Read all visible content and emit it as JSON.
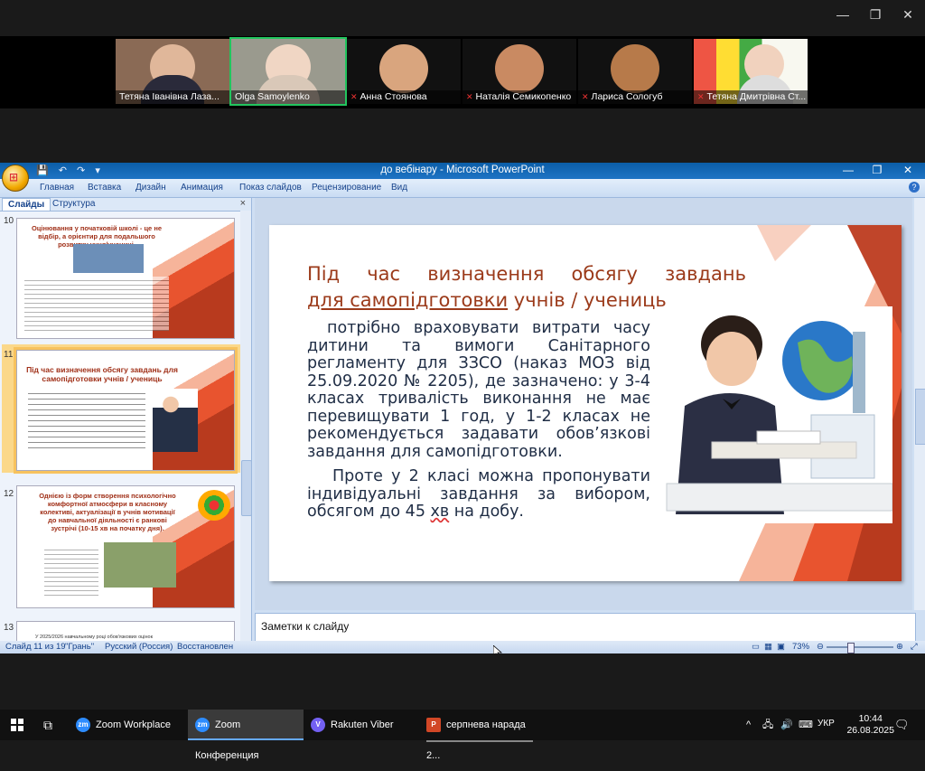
{
  "zoom": {
    "participants": [
      {
        "name": "Тетяна Іванівна Лаза...",
        "muted": false
      },
      {
        "name": "Olga Samoylenko",
        "muted": false
      },
      {
        "name": "Анна Стоянова",
        "muted": true
      },
      {
        "name": "Наталія Семикопенко",
        "muted": true
      },
      {
        "name": "Лариса Сологуб",
        "muted": true
      },
      {
        "name": "Тетяна Дмитрівна Ст...",
        "muted": true
      }
    ],
    "window_controls": {
      "minimize": "—",
      "restore": "❐",
      "close": "✕"
    }
  },
  "ppt": {
    "window_title": "до вебінару - Microsoft PowerPoint",
    "tabs": [
      "Главная",
      "Вставка",
      "Дизайн",
      "Анимация",
      "Показ слайдов",
      "Рецензирование",
      "Вид"
    ],
    "pane_tabs": {
      "slides": "Слайды",
      "outline": "Структура",
      "close": "×"
    },
    "thumbnails": [
      {
        "num": "10",
        "title": "Оцінювання у початковій школі - це не відбір, а орієнтир для подальшого розвитку учня/учениці."
      },
      {
        "num": "11",
        "title": "Під час визначення обсягу завдань для самопідготовки учнів / учениць"
      },
      {
        "num": "12",
        "title": "Однією із форм створення психологічно комфортної атмосфери в класному колективі, актуалізації в учнів мотивації до навчальної діяльності є ранкові зустрічі (10-15 хв на початку дня)."
      },
      {
        "num": "13",
        "title": "У 2025/2026 навчальному році обов'язкових оцінок"
      }
    ],
    "slide": {
      "title_line1": "Під час визначення обсягу завдань",
      "title_line2_underlined": "для самопідготовки",
      "title_line2_rest": " учнів / учениць",
      "para1": "потрібно враховувати витрати часу дитини та вимоги Санітарного регламенту для ЗЗСО (наказ МОЗ від 25.09.2020 № 2205), де зазначено: у 3-4 класах тривалість виконання не має перевищувати 1 год, у 1-2 класах не рекомендується задавати обов’язкові завдання для самопідготовки.",
      "para2_start": "Проте у 2 класі можна пропонувати індивідуальні завдання за вибором, обсягом до 45 ",
      "para2_hv": "хв",
      "para2_end": " на добу."
    },
    "notes_placeholder": "Заметки к слайду",
    "status": {
      "slide": "Слайд 11 из 19",
      "theme": "\"Грань\"",
      "lang": "Русский (Россия)",
      "state": "Восстановлен",
      "zoom": "73%"
    }
  },
  "taskbar": {
    "items": [
      {
        "label": "Zoom Workplace",
        "active": false
      },
      {
        "label": "Zoom Конференция",
        "active": true
      },
      {
        "label": "Rakuten Viber",
        "active": false
      },
      {
        "label": "серпнева нарада 2...",
        "active": false
      }
    ],
    "lang": "УКР",
    "time": "10:44",
    "date": "26.08.2025"
  },
  "colors": {
    "slide_title": "#9b3a1a",
    "accent": "#e8542f",
    "ribbon_blue": "#15428b"
  }
}
